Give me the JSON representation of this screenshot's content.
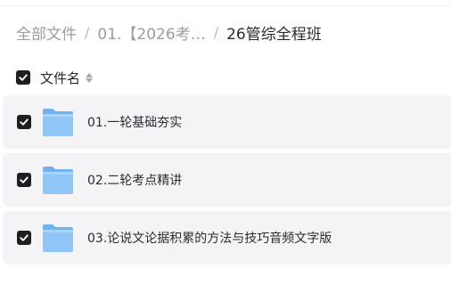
{
  "breadcrumb": {
    "items": [
      "全部文件",
      "01.【2026考…"
    ],
    "separator": "/",
    "current": "26管综全程班"
  },
  "list_header": {
    "column_label": "文件名",
    "sort_icon": "sort-icon"
  },
  "files": [
    {
      "name": "01.一轮基础夯实",
      "icon": "folder-icon",
      "checked": true
    },
    {
      "name": "02.二轮考点精讲",
      "icon": "folder-icon",
      "checked": true
    },
    {
      "name": "03.论说文论据积累的方法与技巧音频文字版",
      "icon": "folder-icon",
      "checked": true
    }
  ],
  "colors": {
    "checkbox": "#1d1e22",
    "row_background": "#f4f4f6",
    "folder_body": "#8fc6f7",
    "folder_tab": "#6eb2f0"
  }
}
